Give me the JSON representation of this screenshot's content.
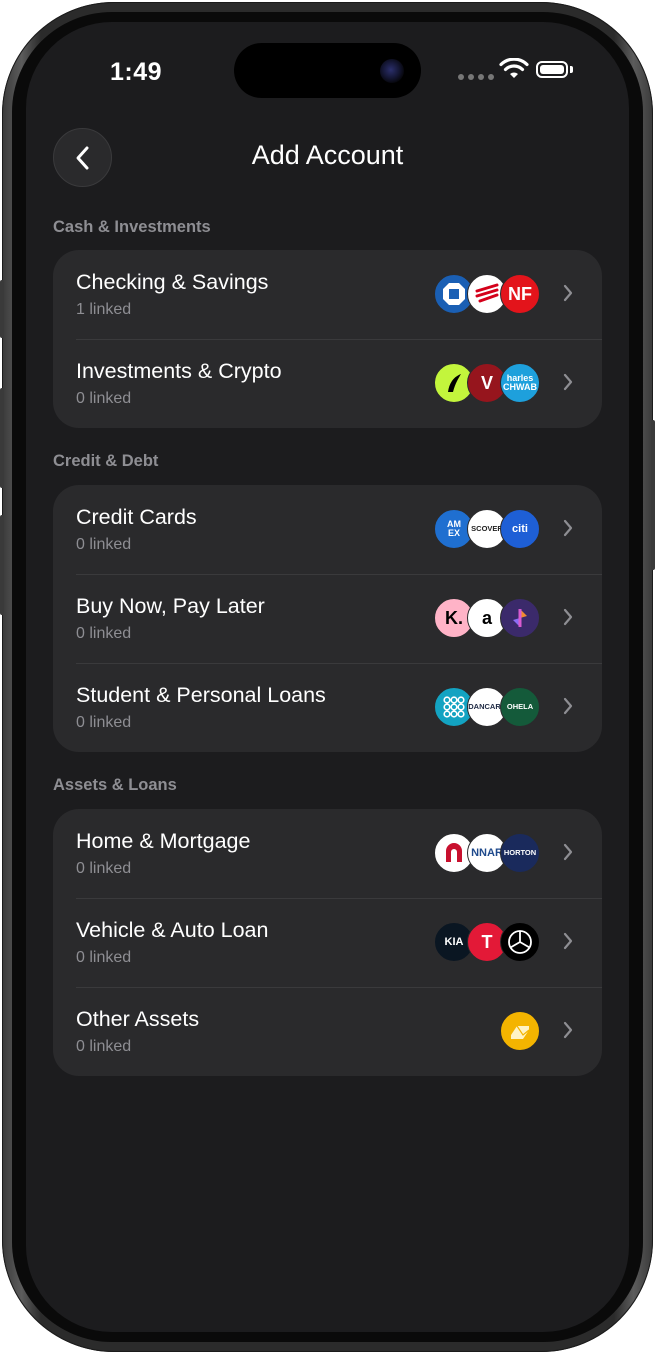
{
  "status_bar": {
    "time": "1:49"
  },
  "header": {
    "title": "Add Account"
  },
  "sections": [
    {
      "title": "Cash & Investments",
      "rows": [
        {
          "title": "Checking & Savings",
          "subtitle": "1 linked",
          "logos": [
            {
              "name": "chase-logo-icon",
              "bg": "#1a5fb4",
              "fg": "#ffffff",
              "text": ""
            },
            {
              "name": "bank-of-america-logo-icon",
              "bg": "#ffffff",
              "fg": "#d4001a",
              "text": ""
            },
            {
              "name": "nf-bank-logo-icon",
              "bg": "#e3141b",
              "fg": "#ffffff",
              "text": "NF"
            }
          ]
        },
        {
          "title": "Investments & Crypto",
          "subtitle": "0 linked",
          "logos": [
            {
              "name": "robinhood-logo-icon",
              "bg": "#c3f53c",
              "fg": "#000000",
              "text": ""
            },
            {
              "name": "vanguard-logo-icon",
              "bg": "#96151d",
              "fg": "#ffffff",
              "text": "V"
            },
            {
              "name": "charles-schwab-logo-icon",
              "bg": "#1ea0dc",
              "fg": "#ffffff",
              "text": "harles\nCHWAB"
            }
          ]
        }
      ]
    },
    {
      "title": "Credit & Debt",
      "rows": [
        {
          "title": "Credit Cards",
          "subtitle": "0 linked",
          "logos": [
            {
              "name": "amex-logo-icon",
              "bg": "#1f6fd0",
              "fg": "#ffffff",
              "text": "AM\nEX"
            },
            {
              "name": "discover-logo-icon",
              "bg": "#ffffff",
              "fg": "#222222",
              "text": "SCOVER"
            },
            {
              "name": "citi-logo-icon",
              "bg": "#1e5fd6",
              "fg": "#ffffff",
              "text": "citi"
            }
          ]
        },
        {
          "title": "Buy Now, Pay Later",
          "subtitle": "0 linked",
          "logos": [
            {
              "name": "klarna-logo-icon",
              "bg": "#ffb3c7",
              "fg": "#000000",
              "text": "K."
            },
            {
              "name": "affirm-logo-icon",
              "bg": "#ffffff",
              "fg": "#000000",
              "text": "a"
            },
            {
              "name": "zip-logo-icon",
              "bg": "#3b2a6b",
              "fg": "#ffffff",
              "text": ""
            }
          ]
        },
        {
          "title": "Student & Personal Loans",
          "subtitle": "0 linked",
          "logos": [
            {
              "name": "sofi-logo-icon",
              "bg": "#13a3c2",
              "fg": "#ffffff",
              "text": ""
            },
            {
              "name": "lendingclub-logo-icon",
              "bg": "#ffffff",
              "fg": "#1f2a44",
              "text": "DANCARE"
            },
            {
              "name": "sallie-mae-logo-icon",
              "bg": "#145a3a",
              "fg": "#ffffff",
              "text": "OHELA"
            }
          ]
        }
      ]
    },
    {
      "title": "Assets & Loans",
      "rows": [
        {
          "title": "Home & Mortgage",
          "subtitle": "0 linked",
          "logos": [
            {
              "name": "rocket-mortgage-logo-icon",
              "bg": "#ffffff",
              "fg": "#c8102e",
              "text": ""
            },
            {
              "name": "lennar-logo-icon",
              "bg": "#ffffff",
              "fg": "#1f4a8c",
              "text": "NNAR"
            },
            {
              "name": "d-r-horton-logo-icon",
              "bg": "#1a2a5c",
              "fg": "#ffffff",
              "text": "HORTON"
            }
          ]
        },
        {
          "title": "Vehicle & Auto Loan",
          "subtitle": "0 linked",
          "logos": [
            {
              "name": "kia-logo-icon",
              "bg": "#0a1622",
              "fg": "#ffffff",
              "text": "KIA"
            },
            {
              "name": "tesla-logo-icon",
              "bg": "#e31937",
              "fg": "#ffffff",
              "text": "T"
            },
            {
              "name": "mercedes-logo-icon",
              "bg": "#000000",
              "fg": "#ffffff",
              "text": ""
            }
          ]
        },
        {
          "title": "Other Assets",
          "subtitle": "0 linked",
          "logos": [
            {
              "name": "gold-bar-icon",
              "bg": "#f4b400",
              "fg": "#fff3c4",
              "text": ""
            }
          ]
        }
      ]
    }
  ],
  "colors": {
    "background": "#1c1c1e",
    "card": "#2a2a2c",
    "secondary_text": "#8e8e93",
    "chevron": "#8e8e93"
  }
}
